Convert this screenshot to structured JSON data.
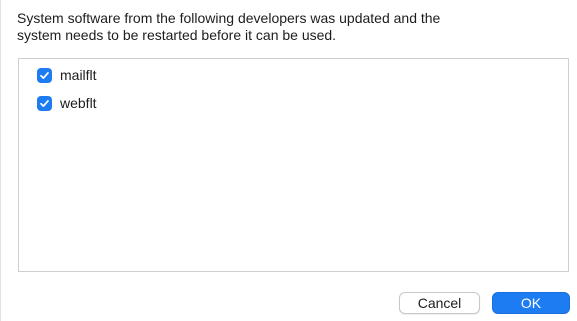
{
  "dialog": {
    "message": "System software from the following developers was updated and the\nsystem needs to be restarted before it can be used.",
    "items": [
      {
        "label": "mailflt",
        "checked": true
      },
      {
        "label": "webflt",
        "checked": true
      }
    ],
    "cancel_label": "Cancel",
    "ok_label": "OK"
  },
  "icons": {
    "checkmark": "checkmark-icon"
  },
  "colors": {
    "accent": "#1e7cf2",
    "list_border": "#cfcfcf",
    "text": "#1d1d1f"
  }
}
